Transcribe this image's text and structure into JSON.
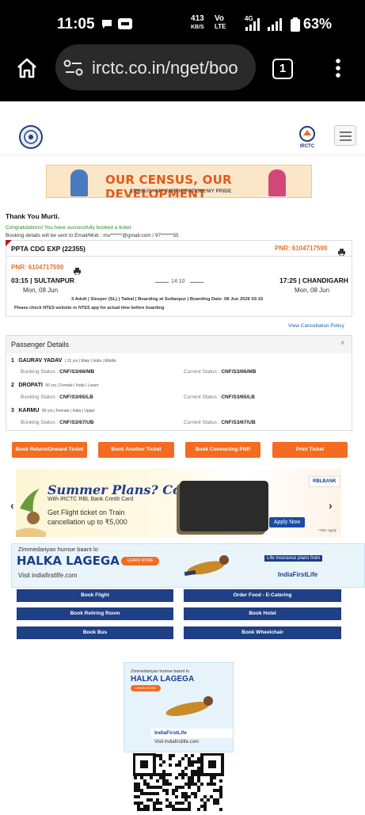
{
  "status_bar": {
    "time": "11:05",
    "net_speed": "413",
    "net_unit": "KB/S",
    "volte1": "Vo",
    "volte2": "LTE",
    "net_type": "4G",
    "battery": "63%"
  },
  "browser": {
    "url": "irctc.co.in/nget/boo",
    "tab_count": "1"
  },
  "census_banner": {
    "title": "OUR CENSUS, OUR DEVELOPMENT",
    "subtitle": "CENSUS - MY PARTICIPATION, MY PRIDE"
  },
  "booking": {
    "thank_you": "Thank You Murti.",
    "congrats": "Congratulations! You have successfully booked a ticket",
    "details_sent": "Booking details will be sent to Email/Mob : mu******@gmail.com / 97******55",
    "train": "PPTA CDG EXP (22355)",
    "pnr_header": "PNR: 6104717590",
    "pnr": "PNR: 6104717590",
    "dep_time_station": "03:15 | SULTANPUR",
    "dep_date": "Mon, 08 Jun",
    "duration": "14:10",
    "arr_time_station": "17:25 | CHANDIGARH",
    "arr_date": "Mon, 08 Jun",
    "summary": "3 Adult | Sleeper (SL) | Tatkal | Boarding at Sultanpur | Boarding Date: 08 Jun 2026 03:15",
    "ntes_note": "Please check NTES website or NTES app for actual time before boarding",
    "cancel_link": "View Cancellation Policy"
  },
  "passengers": {
    "title": "Passenger Details",
    "collapse_glyph": "˄",
    "booking_label": "Booking Status :",
    "current_label": "Current Status :",
    "list": [
      {
        "num": "1",
        "name": "GAURAV YADAV",
        "info": "| 15 yrs | Male | India | Middle",
        "booking": "CNF/S3/66/MB",
        "current": "CNF/S3/66/MB"
      },
      {
        "num": "2",
        "name": "DROPATI",
        "info": "50 yrs | Female | India | Lower",
        "booking": "CNF/S3/65/LB",
        "current": "CNF/S3/65/LB"
      },
      {
        "num": "3",
        "name": "KARMU",
        "info": "80 yrs | Female | India | Upper",
        "booking": "CNF/S3/67/UB",
        "current": "CNF/S3/67/UB"
      }
    ]
  },
  "actions": [
    "Book Return/Onward Ticket",
    "Book Another Ticket",
    "Book Connecting PNR",
    "Print Ticket"
  ],
  "rbl_ad": {
    "headline": "Summer Plans? Confirmed.",
    "line1": "With IRCTC RBL Bank Credit Card",
    "line2": "Get Flight ticket on Train",
    "line3": "cancellation up to ₹5,000",
    "apply": "Apply Now",
    "brand": "RBLBANK",
    "tc": "*T&C Apply"
  },
  "life_ad": {
    "tagline": "Zimmedariyan humse baant lo",
    "headline": "HALKA LAGEGA",
    "learn": "LEARN MORE",
    "visit": "Visit indiafirstlife.com",
    "right_text": "Life insurance plans from",
    "brand": "IndiaFirstLife"
  },
  "services": [
    "Book Flight",
    "Order Food - E-Catering",
    "Book Retiring Room",
    "Book Hotel",
    "Book Bus",
    "Book Wheelchair"
  ],
  "small_ad": {
    "tagline": "Zimmedariyan humse baant lo",
    "headline": "HALKA LAGEGA",
    "learn": "LEARN MORE",
    "brand": "IndiaFirstLife",
    "visit": "Visit indiafirstlife.com"
  },
  "colors": {
    "accent": "#f36c21",
    "navy": "#1f3f86",
    "green": "#2a8c2a"
  }
}
